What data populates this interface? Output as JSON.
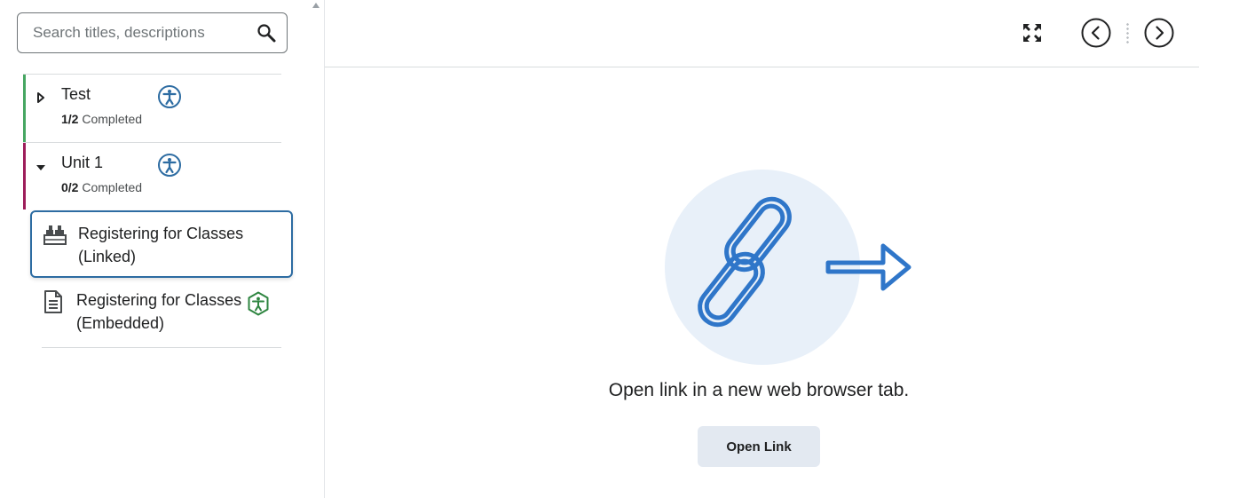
{
  "search": {
    "placeholder": "Search titles, descriptions"
  },
  "modules": [
    {
      "title": "Test",
      "completed_count": "1/2",
      "completed_label": "Completed",
      "accent": "#46a661"
    },
    {
      "title": "Unit 1",
      "completed_count": "0/2",
      "completed_label": "Completed",
      "accent": "#9d1d5a"
    }
  ],
  "topics": [
    {
      "line1": "Registering for Classes",
      "line2": "(Linked)",
      "icon": "link-topic-icon",
      "selected": true
    },
    {
      "line1": "Registering for Classes",
      "line2": "(Embedded)",
      "icon": "document-icon",
      "selected": false
    }
  ],
  "content": {
    "message": "Open link in a new web browser tab.",
    "open_button": "Open Link"
  },
  "colors": {
    "primary": "#2d6ca2",
    "link_blue": "#2f76c9",
    "hero_bg": "#e8f0f9",
    "a11y_green": "#2e8540"
  },
  "icons": [
    "search-icon",
    "caret-right-icon",
    "caret-down-icon",
    "accessibility-icon",
    "expand-fullscreen-icon",
    "chevron-left-icon",
    "chevron-right-icon",
    "link-icon",
    "arrow-right-icon"
  ]
}
